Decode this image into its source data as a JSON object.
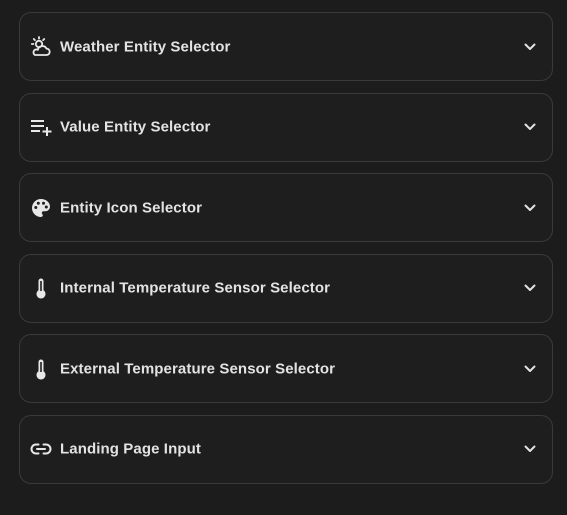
{
  "panels": [
    {
      "label": "Weather Entity Selector",
      "icon": "weather-partly-cloudy-icon"
    },
    {
      "label": "Value Entity Selector",
      "icon": "playlist-plus-icon"
    },
    {
      "label": "Entity Icon Selector",
      "icon": "palette-icon"
    },
    {
      "label": "Internal Temperature Sensor Selector",
      "icon": "thermometer-icon"
    },
    {
      "label": "External Temperature Sensor Selector",
      "icon": "thermometer-icon"
    },
    {
      "label": "Landing Page Input",
      "icon": "link-icon"
    }
  ],
  "colors": {
    "background": "#1c1c1c",
    "panel_border": "#3a3a3a",
    "text": "#e3e3e3",
    "icon": "#e8e8e8"
  }
}
